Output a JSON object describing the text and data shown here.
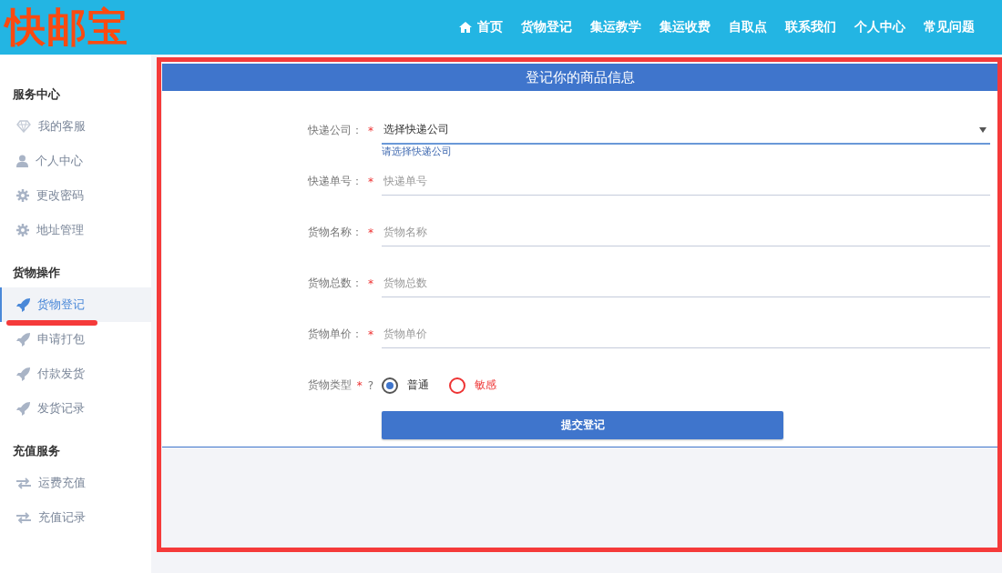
{
  "header": {
    "logo": "快邮宝",
    "nav": [
      {
        "label": "首页",
        "kind": "home"
      },
      {
        "label": "货物登记"
      },
      {
        "label": "集运教学"
      },
      {
        "label": "集运收费"
      },
      {
        "label": "自取点"
      },
      {
        "label": "联系我们"
      },
      {
        "label": "个人中心"
      },
      {
        "label": "常见问题"
      }
    ]
  },
  "sidebar": {
    "sections": [
      {
        "title": "服务中心",
        "items": [
          {
            "label": "我的客服",
            "kind": "diamond",
            "selected": false
          },
          {
            "label": "个人中心",
            "kind": "user",
            "selected": false
          },
          {
            "label": "更改密码",
            "kind": "gear",
            "selected": false
          },
          {
            "label": "地址管理",
            "kind": "gear",
            "selected": false
          }
        ]
      },
      {
        "title": "货物操作",
        "items": [
          {
            "label": "货物登记",
            "kind": "rocket",
            "selected": true
          },
          {
            "label": "申请打包",
            "kind": "rocket",
            "selected": false
          },
          {
            "label": "付款发货",
            "kind": "rocket",
            "selected": false
          },
          {
            "label": "发货记录",
            "kind": "rocket",
            "selected": false
          }
        ]
      },
      {
        "title": "充值服务",
        "items": [
          {
            "label": "运费充值",
            "kind": "exchange",
            "selected": false
          },
          {
            "label": "充值记录",
            "kind": "exchange",
            "selected": false
          }
        ]
      }
    ]
  },
  "form": {
    "title": "登记你的商品信息",
    "fields": [
      {
        "kind": "select",
        "label": "快递公司：",
        "required": "*",
        "value": "选择快递公司",
        "hint": "请选择快递公司"
      },
      {
        "kind": "text",
        "label": "快递单号：",
        "required": "*",
        "placeholder": "快递单号"
      },
      {
        "kind": "text",
        "label": "货物名称：",
        "required": "*",
        "placeholder": "货物名称"
      },
      {
        "kind": "text",
        "label": "货物总数：",
        "required": "*",
        "placeholder": "货物总数"
      },
      {
        "kind": "text",
        "label": "货物单价：",
        "required": "*",
        "placeholder": "货物单价"
      },
      {
        "kind": "radio",
        "label": "货物类型",
        "required": "*",
        "help": "?",
        "options": [
          {
            "label": "普通",
            "selected": true
          },
          {
            "label": "敏感",
            "selected": false
          }
        ]
      }
    ],
    "submit": "提交登记"
  }
}
